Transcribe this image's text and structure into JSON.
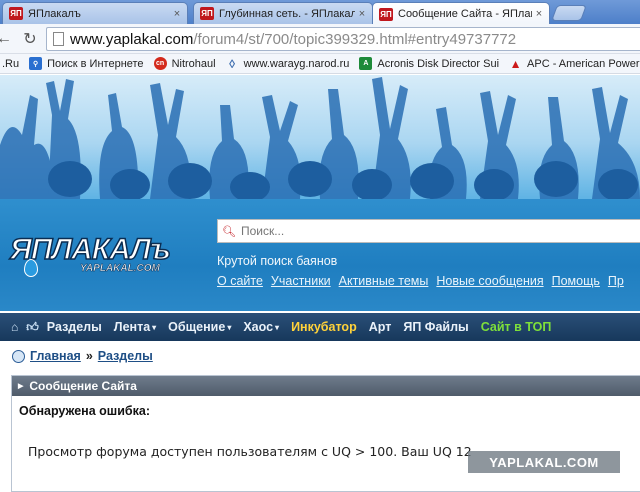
{
  "browser": {
    "tabs": [
      {
        "favicon": "ЯП",
        "label": "ЯПлакалъ",
        "close": "×",
        "active": false
      },
      {
        "favicon": "ЯП",
        "label": "Глубинная сеть. - ЯПлакал",
        "close": "×",
        "active": false
      },
      {
        "favicon": "ЯП",
        "label": "Сообщение Сайта - ЯПлака",
        "close": "×",
        "active": true
      }
    ],
    "back_icon": "←",
    "reload_icon": "↻",
    "url_host": "www.yaplakal.com",
    "url_path": "/forum4/st/700/topic399329.html#entry49737772"
  },
  "bookmarks": [
    {
      "label": ".Ru",
      "icon": "",
      "color": ""
    },
    {
      "label": "Поиск в Интернете",
      "icon": "search-icon",
      "color": "#2a6fd0"
    },
    {
      "label": "Nitrohaul",
      "icon": "nitro-icon",
      "color": "#d42a1c"
    },
    {
      "label": "www.warayg.narod.ru",
      "icon": "diamond-icon",
      "color": "#3f6fb0"
    },
    {
      "label": "Acronis Disk Director Sui",
      "icon": "acronis-icon",
      "color": "#1e8a3a"
    },
    {
      "label": "APC - American Power C",
      "icon": "apc-icon",
      "color": "#cc1a1a"
    }
  ],
  "site": {
    "logo_main": "ЯПЛАКАЛъ",
    "logo_sub": "YAPLAKAL.COM",
    "search_placeholder": "Поиск...",
    "slogan": "Крутой поиск баянов",
    "top_links": [
      "О сайте",
      "Участники",
      "Активные темы",
      "Новые сообщения",
      "Помощь",
      "Пр"
    ],
    "nav": [
      {
        "label": "Разделы",
        "dropdown": false,
        "style": "normal"
      },
      {
        "label": "Лента",
        "dropdown": true,
        "style": "normal"
      },
      {
        "label": "Общение",
        "dropdown": true,
        "style": "normal"
      },
      {
        "label": "Хаос",
        "dropdown": true,
        "style": "normal"
      },
      {
        "label": "Инкубатор",
        "dropdown": false,
        "style": "yellow"
      },
      {
        "label": "Арт",
        "dropdown": false,
        "style": "normal"
      },
      {
        "label": "ЯП Файлы",
        "dropdown": false,
        "style": "normal"
      },
      {
        "label": "Сайт в ТОП",
        "dropdown": false,
        "style": "green"
      }
    ],
    "nav_arrow": "▾",
    "breadcrumb": {
      "home": "Главная",
      "separator": "»",
      "current": "Разделы"
    },
    "box_title": "Сообщение Сайта",
    "error_title": "Обнаружена ошибка:",
    "error_message": "Просмотр форума доступен пользователям с UQ > 100. Ваш UQ 12",
    "watermark": "YAPLAKAL.COM"
  },
  "colors": {
    "nav_bg": "#1f436b",
    "header_blue": "#2a88c8",
    "accent_red": "#c0171d",
    "nav_yellow": "#ffd23a",
    "nav_green": "#7ee03a"
  }
}
